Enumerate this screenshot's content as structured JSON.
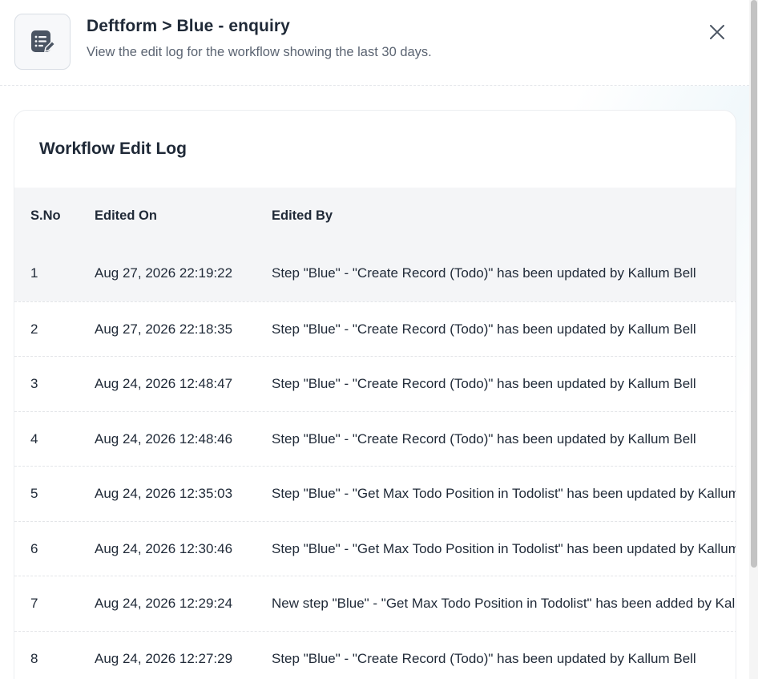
{
  "header": {
    "title": "Deftform > Blue - enquiry",
    "subtitle": "View the edit log for the workflow showing the last 30 days.",
    "icon": "form-edit-icon",
    "close_icon": "close-icon"
  },
  "card": {
    "title": "Workflow Edit Log"
  },
  "table": {
    "columns": [
      "S.No",
      "Edited On",
      "Edited By"
    ],
    "rows": [
      {
        "sno": "1",
        "edited_on": "Aug 27, 2026 22:19:22",
        "edited_by": "Step \"Blue\" - \"Create Record (Todo)\" has been updated by Kallum Bell"
      },
      {
        "sno": "2",
        "edited_on": "Aug 27, 2026 22:18:35",
        "edited_by": "Step \"Blue\" - \"Create Record (Todo)\" has been updated by Kallum Bell"
      },
      {
        "sno": "3",
        "edited_on": "Aug 24, 2026 12:48:47",
        "edited_by": "Step \"Blue\" - \"Create Record (Todo)\" has been updated by Kallum Bell"
      },
      {
        "sno": "4",
        "edited_on": "Aug 24, 2026 12:48:46",
        "edited_by": "Step \"Blue\" - \"Create Record (Todo)\" has been updated by Kallum Bell"
      },
      {
        "sno": "5",
        "edited_on": "Aug 24, 2026 12:35:03",
        "edited_by": "Step \"Blue\" - \"Get Max Todo Position in Todolist\" has been updated by Kallum Bell"
      },
      {
        "sno": "6",
        "edited_on": "Aug 24, 2026 12:30:46",
        "edited_by": "Step \"Blue\" - \"Get Max Todo Position in Todolist\" has been updated by Kallum Bell"
      },
      {
        "sno": "7",
        "edited_on": "Aug 24, 2026 12:29:24",
        "edited_by": "New step \"Blue\" - \"Get Max Todo Position in Todolist\" has been added by Kallum Bell"
      },
      {
        "sno": "8",
        "edited_on": "Aug 24, 2026 12:27:29",
        "edited_by": "Step \"Blue\" - \"Create Record (Todo)\" has been updated by Kallum Bell"
      }
    ]
  },
  "colors": {
    "text": "#1f2937",
    "muted": "#5b6472",
    "header_row_bg": "#f4f5f7"
  }
}
